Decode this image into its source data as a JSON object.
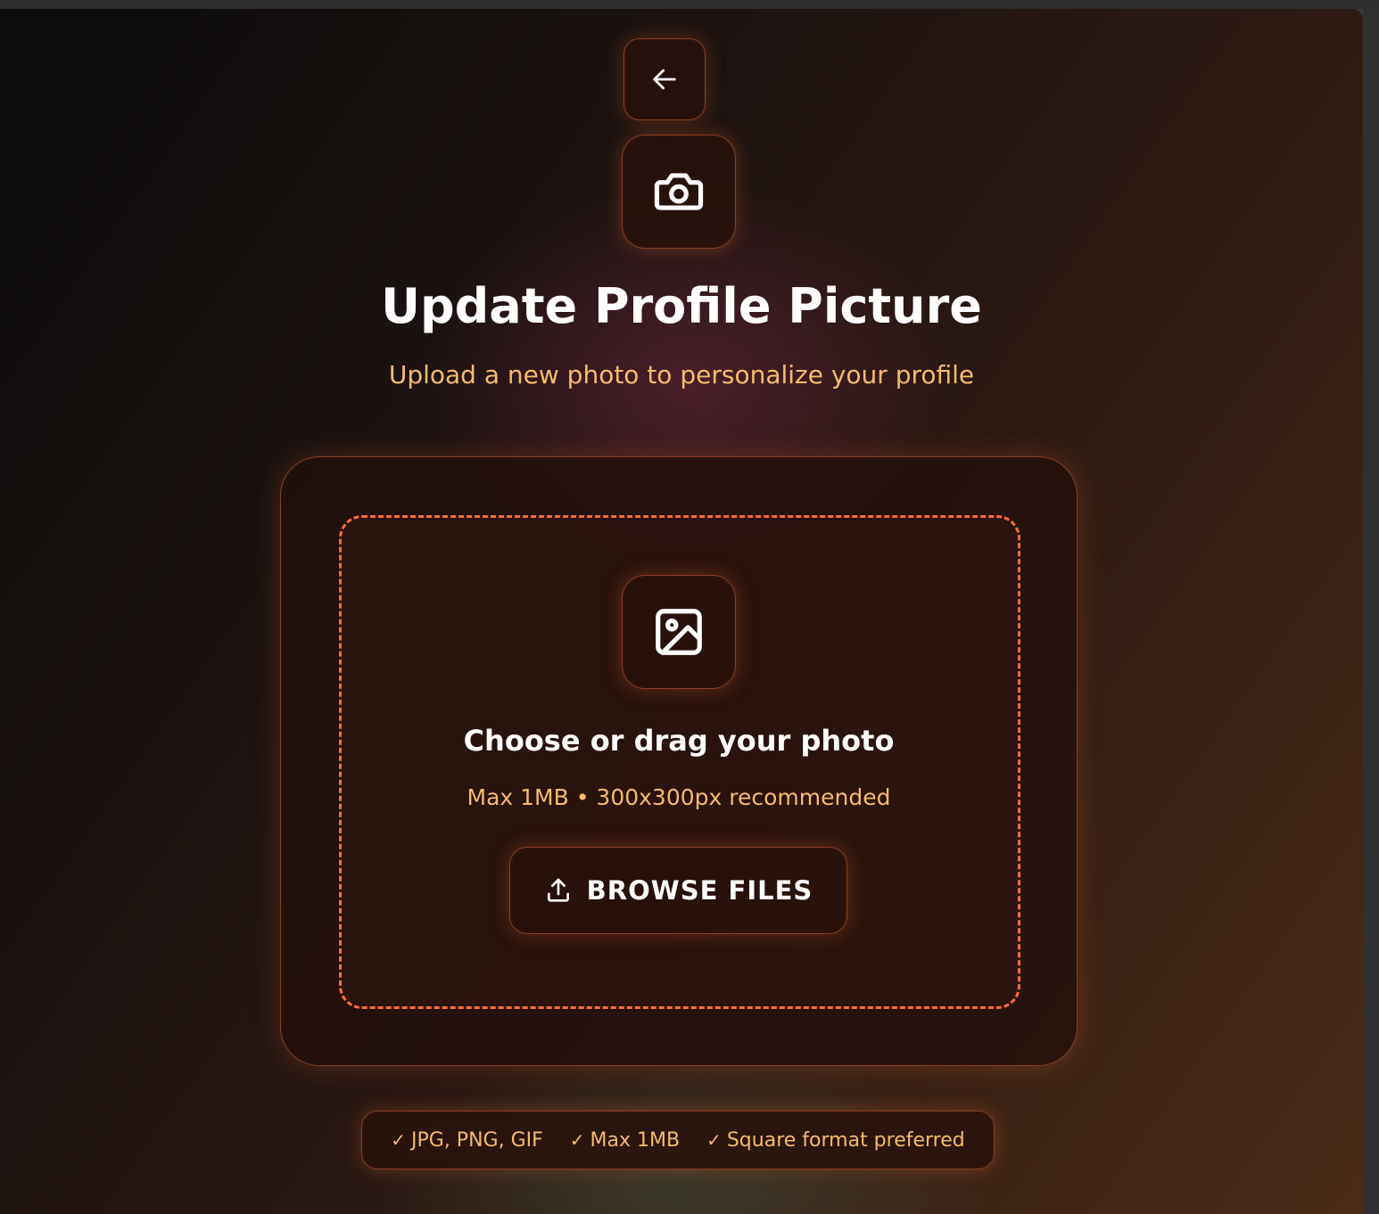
{
  "header": {
    "title": "Update Profile Picture",
    "subtitle": "Upload a new photo to personalize your profile"
  },
  "icons": {
    "back": "arrow-left-icon",
    "camera": "camera-icon",
    "image": "image-icon",
    "upload": "upload-icon",
    "check": "check-icon"
  },
  "upload": {
    "heading": "Choose or drag your photo",
    "limits": "Max 1MB • 300x300px recommended",
    "browse_label": "BROWSE FILES"
  },
  "requirements": [
    {
      "label": "JPG, PNG, GIF"
    },
    {
      "label": "Max 1MB"
    },
    {
      "label": "Square format preferred"
    }
  ],
  "colors": {
    "accent": "#ff6a3a",
    "subtitle": "#f6bb6c",
    "border": "#8a3f22"
  }
}
